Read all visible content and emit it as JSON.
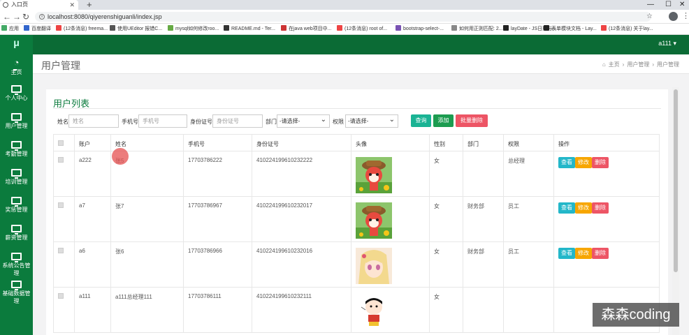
{
  "browser": {
    "tab_title": "入口页",
    "url": "localhost:8080/qiyerenshiguanli/index.jsp",
    "bookmarks": [
      "应用",
      "百度翻译",
      "(12条消息) freema...",
      "使用UEditor 报错C...",
      "mysql如何修改roo...",
      "README.md - Ter...",
      "在java web项目中...",
      "(12条消息) root of...",
      "bootstrap-select-...",
      "如何用正则匹配: 2...",
      "layDate - JS日期与...",
      "表单模块文档 - Lay...",
      "(12条消息) 关于lay..."
    ]
  },
  "sidebar": {
    "logo": "μ",
    "items": [
      "主页",
      "个人中心",
      "用户管理",
      "考勤管理",
      "培训管理",
      "奖惩管理",
      "薪资管理",
      "系统公告管理",
      "基础数据管理"
    ]
  },
  "topbar": {
    "user": "a111 ▾"
  },
  "page": {
    "title": "用户管理",
    "breadcrumb": [
      "主页",
      "用户管理",
      "用户管理"
    ]
  },
  "panel": {
    "title": "用户列表",
    "filters": {
      "name_label": "姓名",
      "name_placeholder": "姓名",
      "phone_label": "手机号",
      "phone_placeholder": "手机号",
      "id_label": "身份证号",
      "id_placeholder": "身份证号",
      "dept_label": "部门",
      "dept_value": "-请选择-",
      "role_label": "权限",
      "role_value": "-请选择-"
    },
    "buttons": {
      "query": "查询",
      "add": "添加",
      "batch_delete": "批量删除"
    }
  },
  "table": {
    "headers": [
      "",
      "账户",
      "姓名",
      "手机号",
      "身份证号",
      "头像",
      "性别",
      "部门",
      "权限",
      "操作"
    ],
    "rows": [
      {
        "account": "a222",
        "name": "张5",
        "phone": "17703786222",
        "idcard": "410224199610232222",
        "avatar": "fox-avatar",
        "gender": "女",
        "dept": "",
        "role": "总经理"
      },
      {
        "account": "a7",
        "name": "张7",
        "phone": "17703786967",
        "idcard": "410224199610232017",
        "avatar": "fox-avatar",
        "gender": "女",
        "dept": "财务部",
        "role": "员工"
      },
      {
        "account": "a6",
        "name": "张6",
        "phone": "17703786966",
        "idcard": "410224199610232016",
        "avatar": "anime-girl-avatar",
        "gender": "女",
        "dept": "财务部",
        "role": "员工"
      },
      {
        "account": "a111",
        "name": "a111总经理111",
        "phone": "17703786111",
        "idcard": "410224199610232111",
        "avatar": "cartoon-boy-avatar",
        "gender": "女",
        "dept": "",
        "role": ""
      }
    ],
    "ops": {
      "view": "查看",
      "edit": "修改",
      "delete": "删除"
    }
  },
  "watermark": "森森coding",
  "colors": {
    "sidebar": "#0b7b3d",
    "topbar": "#0b6b35",
    "view_btn": "#23b7c9",
    "edit_btn": "#f7a600",
    "delete_btn": "#ed5565",
    "primary": "#1ab394"
  }
}
